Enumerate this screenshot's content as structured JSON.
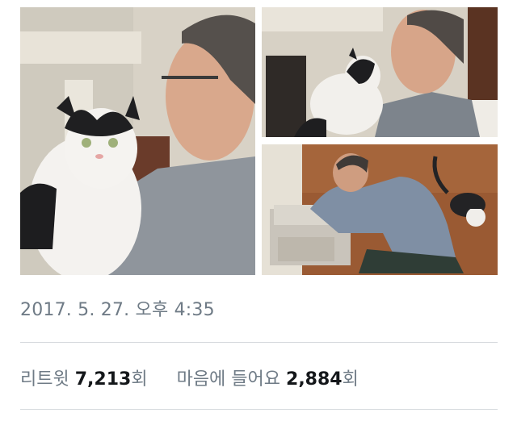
{
  "tweet": {
    "photos": [
      {
        "alt": "man holding black and white cat"
      },
      {
        "alt": "cat on man's shoulder"
      },
      {
        "alt": "man cleaning litter box with cat nearby"
      }
    ],
    "timestamp": "2017. 5. 27. 오후 4:35",
    "stats": {
      "retweet_label": "리트윗",
      "retweet_count": "7,213",
      "retweet_suffix": "회",
      "like_label": "마음에 들어요",
      "like_count": "2,884",
      "like_suffix": "회"
    }
  }
}
